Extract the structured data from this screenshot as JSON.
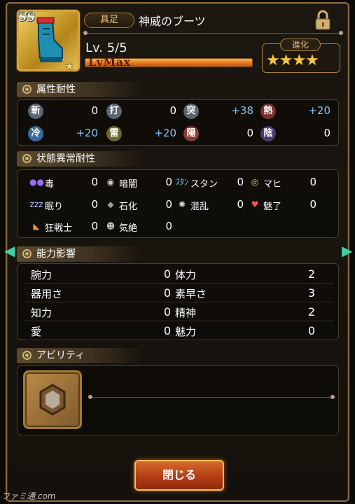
{
  "header": {
    "rank": "SS",
    "type_tag": "具足",
    "item_name": "神威のブーツ",
    "level": "Lv. 5/5",
    "lvmax": "LvMax",
    "evolution_label": "進化",
    "evolution_stars": "★★★★",
    "star_small": "★"
  },
  "attribute_section": {
    "title": "属性耐性",
    "items": [
      {
        "glyph": "斬",
        "value": "0",
        "color": "#5c6470",
        "blue": false
      },
      {
        "glyph": "打",
        "value": "0",
        "color": "#5c6470",
        "blue": false
      },
      {
        "glyph": "突",
        "value": "+38",
        "color": "#5c6470",
        "blue": true
      },
      {
        "glyph": "熱",
        "value": "+20",
        "color": "#7a2f2f",
        "blue": true
      },
      {
        "glyph": "冷",
        "value": "+20",
        "color": "#3b6a9a",
        "blue": true
      },
      {
        "glyph": "雷",
        "value": "+20",
        "color": "#6a6a30",
        "blue": true
      },
      {
        "glyph": "陽",
        "value": "0",
        "color": "#8a3b30",
        "blue": false
      },
      {
        "glyph": "陰",
        "value": "0",
        "color": "#4a3a70",
        "blue": false
      }
    ]
  },
  "status_section": {
    "title": "状態異常耐性",
    "items": [
      {
        "icon": "●●",
        "label": "毒",
        "value": "0",
        "color": "#9b6dff"
      },
      {
        "icon": "◉",
        "label": "暗闇",
        "value": "0",
        "color": "#cccccc"
      },
      {
        "icon": "ｽﾀﾝ",
        "label": "スタン",
        "value": "0",
        "color": "#7ab8ff"
      },
      {
        "icon": "◎",
        "label": "マヒ",
        "value": "0",
        "color": "#f0d040"
      },
      {
        "icon": "zzz",
        "label": "眠り",
        "value": "0",
        "color": "#b8c8ff"
      },
      {
        "icon": "◆",
        "label": "石化",
        "value": "0",
        "color": "#9a9a9a"
      },
      {
        "icon": "✺",
        "label": "混乱",
        "value": "0",
        "color": "#dddddd"
      },
      {
        "icon": "♥",
        "label": "魅了",
        "value": "0",
        "color": "#ff5050"
      },
      {
        "icon": "◣",
        "label": "狂戦士",
        "value": "0",
        "color": "#ff8a2a"
      },
      {
        "icon": "☻",
        "label": "気絶",
        "value": "0",
        "color": "#bdbdbd"
      }
    ]
  },
  "ability_section": {
    "title": "能力影響",
    "rows": [
      {
        "left_label": "腕力",
        "left_value": "0",
        "right_label": "体力",
        "right_value": "2"
      },
      {
        "left_label": "器用さ",
        "left_value": "0",
        "right_label": "素早さ",
        "right_value": "3"
      },
      {
        "left_label": "知力",
        "left_value": "0",
        "right_label": "精神",
        "right_value": "2"
      },
      {
        "left_label": "愛",
        "left_value": "0",
        "right_label": "魅力",
        "right_value": "0"
      }
    ]
  },
  "skill_section": {
    "title": "アビリティ"
  },
  "close_button": "閉じる",
  "watermark": "ファミ通.com",
  "colors": {
    "accent_gold": "#d7a53c",
    "value_blue": "#7ec4ff",
    "button_red": "#b43d14"
  }
}
